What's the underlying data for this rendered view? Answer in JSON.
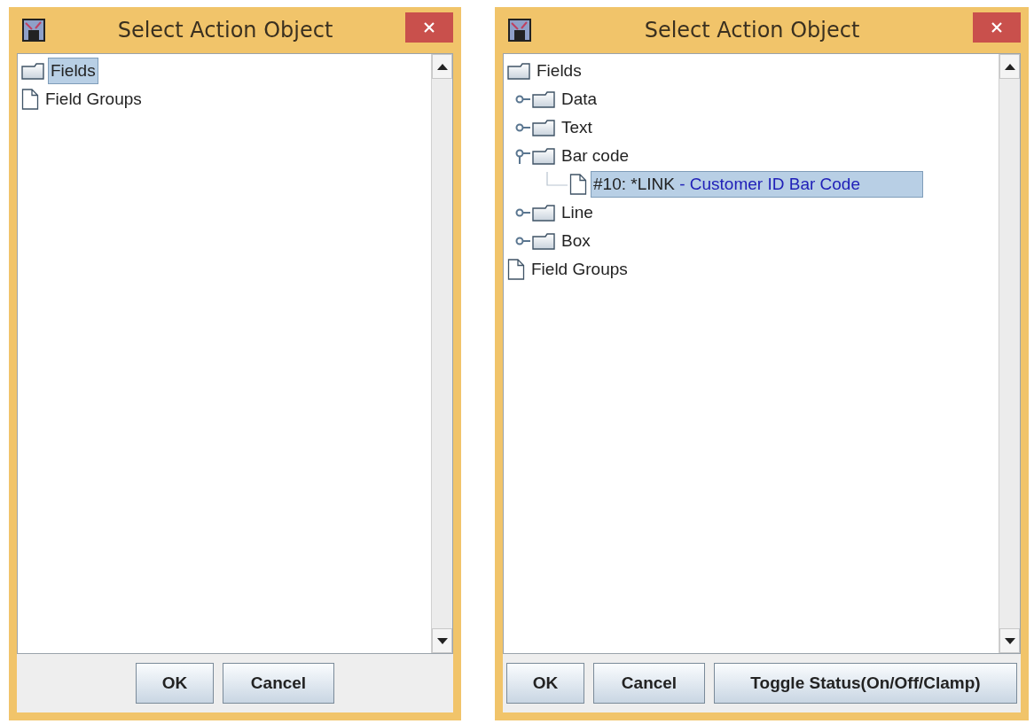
{
  "dialogs": [
    {
      "title": "Select Action Object",
      "tree": [
        {
          "label": "Fields",
          "kind": "folder",
          "selected": true
        },
        {
          "label": "Field Groups",
          "kind": "file",
          "selected": false
        }
      ],
      "buttons": [
        "OK",
        "Cancel"
      ]
    },
    {
      "title": "Select Action Object",
      "tree": [
        {
          "label": "Fields",
          "kind": "folder",
          "selected": false,
          "children": [
            {
              "label": "Data",
              "kind": "folder",
              "selected": false,
              "expanded": false
            },
            {
              "label": "Text",
              "kind": "folder",
              "selected": false,
              "expanded": false
            },
            {
              "label": "Bar code",
              "kind": "folder",
              "selected": false,
              "expanded": true,
              "children": [
                {
                  "label": "#10: *LINK",
                  "description": "- Customer ID Bar Code",
                  "kind": "file",
                  "selected": true
                }
              ]
            },
            {
              "label": "Line",
              "kind": "folder",
              "selected": false,
              "expanded": false
            },
            {
              "label": "Box",
              "kind": "folder",
              "selected": false,
              "expanded": false
            }
          ]
        },
        {
          "label": "Field Groups",
          "kind": "file",
          "selected": false
        }
      ],
      "buttons": [
        "OK",
        "Cancel",
        "Toggle Status(On/Off/Clamp)"
      ]
    }
  ]
}
